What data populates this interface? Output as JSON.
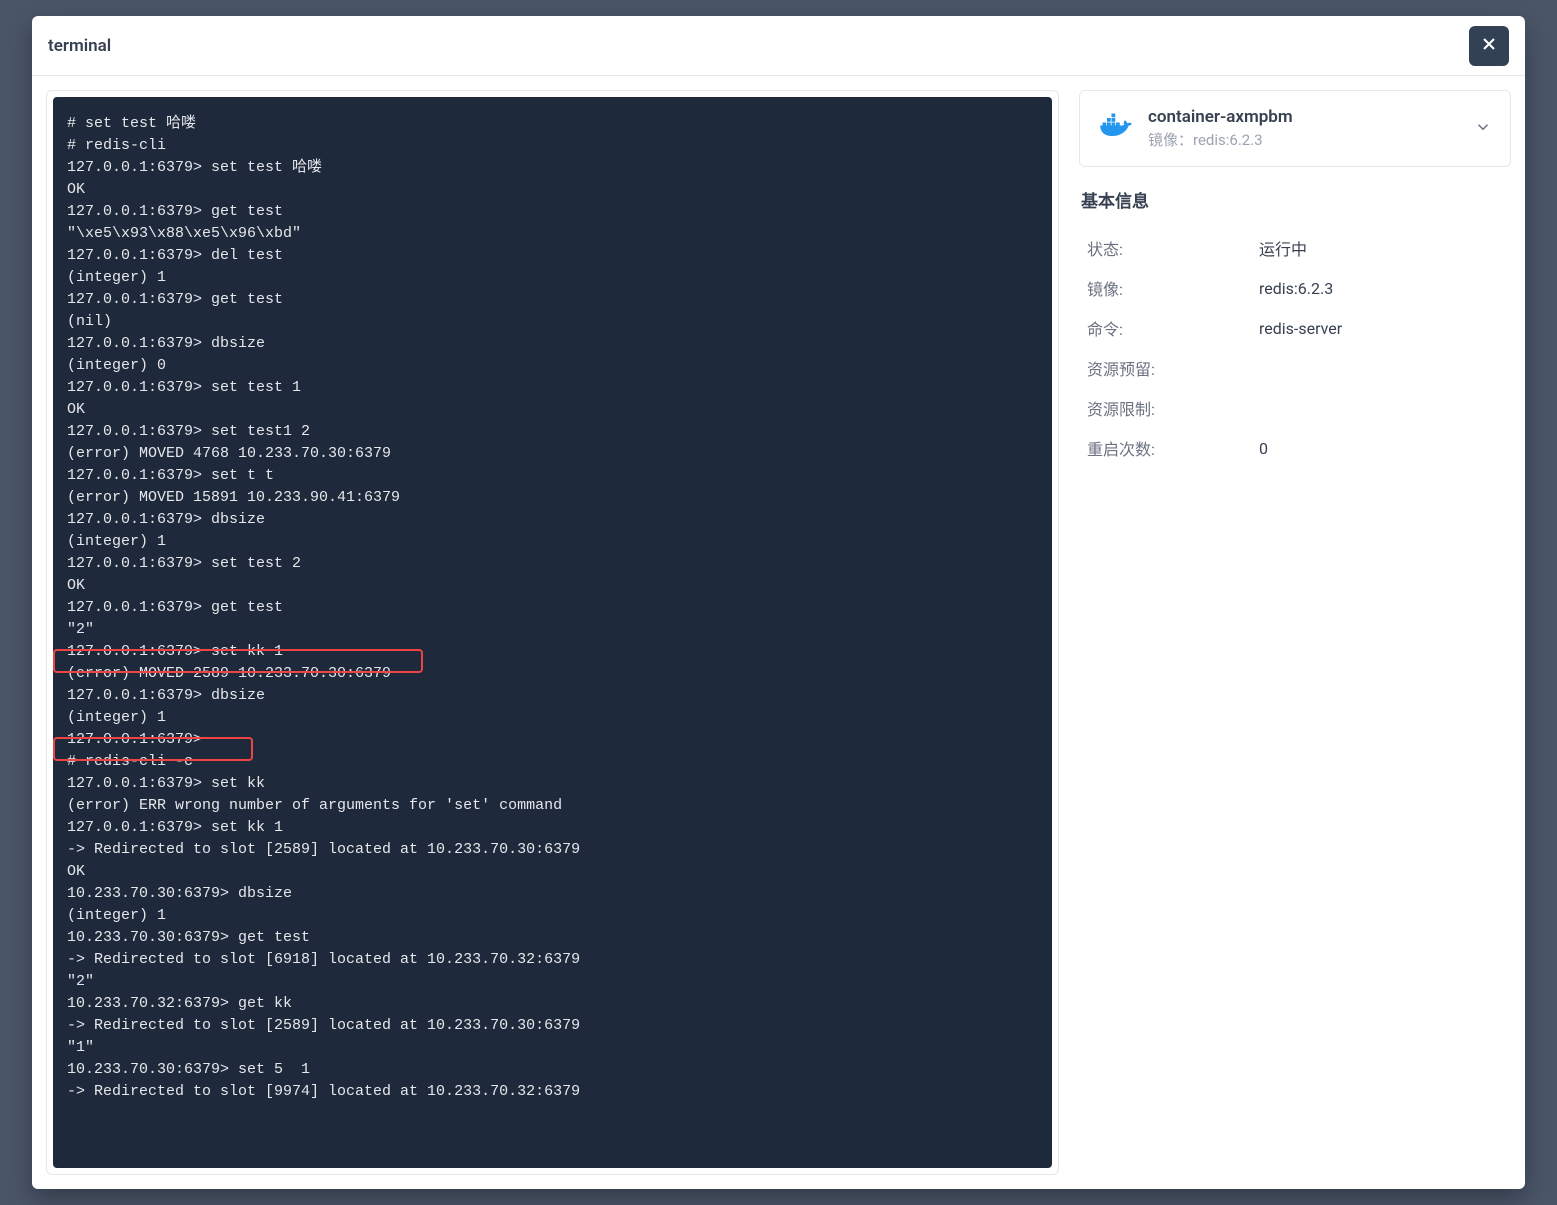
{
  "modal": {
    "title": "terminal"
  },
  "terminal": {
    "lines": [
      "# set test 哈喽",
      "# redis-cli",
      "127.0.0.1:6379> set test 哈喽",
      "OK",
      "127.0.0.1:6379> get test",
      "\"\\xe5\\x93\\x88\\xe5\\x96\\xbd\"",
      "127.0.0.1:6379> del test",
      "(integer) 1",
      "127.0.0.1:6379> get test",
      "(nil)",
      "127.0.0.1:6379> dbsize",
      "(integer) 0",
      "127.0.0.1:6379> set test 1",
      "OK",
      "127.0.0.1:6379> set test1 2",
      "(error) MOVED 4768 10.233.70.30:6379",
      "127.0.0.1:6379> set t t",
      "(error) MOVED 15891 10.233.90.41:6379",
      "127.0.0.1:6379> dbsize",
      "(integer) 1",
      "127.0.0.1:6379> set test 2",
      "OK",
      "127.0.0.1:6379> get test",
      "\"2\"",
      "127.0.0.1:6379> set kk 1",
      "(error) MOVED 2589 10.233.70.30:6379",
      "127.0.0.1:6379> dbsize",
      "(integer) 1",
      "127.0.0.1:6379>",
      "# redis-cli -c",
      "127.0.0.1:6379> set kk",
      "(error) ERR wrong number of arguments for 'set' command",
      "127.0.0.1:6379> set kk 1",
      "-> Redirected to slot [2589] located at 10.233.70.30:6379",
      "OK",
      "10.233.70.30:6379> dbsize",
      "(integer) 1",
      "10.233.70.30:6379> get test",
      "-> Redirected to slot [6918] located at 10.233.70.32:6379",
      "\"2\"",
      "10.233.70.32:6379> get kk",
      "-> Redirected to slot [2589] located at 10.233.70.30:6379",
      "\"1\"",
      "10.233.70.30:6379> set 5  1",
      "-> Redirected to slot [9974] located at 10.233.70.32:6379"
    ]
  },
  "container": {
    "name": "container-axmpbm",
    "subtitle_prefix": "镜像：",
    "subtitle_value": "redis:6.2.3"
  },
  "info": {
    "title": "基本信息",
    "rows": [
      {
        "key": "状态:",
        "val": "运行中"
      },
      {
        "key": "镜像:",
        "val": "redis:6.2.3"
      },
      {
        "key": "命令:",
        "val": "redis-server"
      },
      {
        "key": "资源预留:",
        "val": ""
      },
      {
        "key": "资源限制:",
        "val": ""
      },
      {
        "key": "重启次数:",
        "val": "0"
      }
    ]
  }
}
